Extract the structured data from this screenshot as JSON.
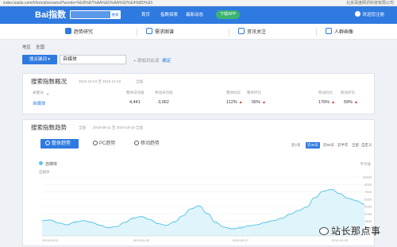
{
  "browser": {
    "url": "index.baidu.com/#/trend/seoword?words=%E8%87%AA%E5%AA%92%E4%BD%93",
    "right_info": "北京百度网讯科技有限公司"
  },
  "topnav": {
    "logo": "Bai指数",
    "search_btn": "搜索",
    "links": [
      "首页",
      "指数探索",
      "最新动态"
    ],
    "pill": "下载APP",
    "user": "欢迎您注册"
  },
  "tabs": [
    "趋势研究",
    "需求图谱",
    "资讯关注",
    "人群画像"
  ],
  "filters": {
    "region": [
      "地区",
      "全国"
    ],
    "keyword_btn": "搜关键词",
    "keyword_value": "自媒体",
    "add_compare": "+ 添加对比词",
    "confirm": "确定"
  },
  "overview": {
    "title": "搜索指数概况",
    "date_range": "2019-10-04 至 2019-10-10",
    "scope": "全国",
    "headers": [
      "关键词",
      "整体日均值",
      "移动日均值",
      "整体同比",
      "整体环比",
      "移动同比",
      "移动环比"
    ],
    "row": {
      "keyword": "自媒体",
      "overall_avg": "4,441",
      "mobile_avg": "3,062",
      "overall_yoy": "112%",
      "overall_mom": "56%",
      "mobile_yoy": "176%",
      "mobile_mom": "59%"
    }
  },
  "trend": {
    "title": "搜索指数趋势",
    "scope": "全国",
    "date_range": "2019-09-11 至 2019-10-10",
    "tabs": [
      "整体趋势",
      "PC趋势",
      "移动趋势"
    ],
    "ranges": [
      "近7天",
      "近30天",
      "近90天",
      "近半年",
      "全部",
      "自定义"
    ],
    "selected_range": "近30天",
    "legend": "自媒体",
    "avg_label": "平均值"
  },
  "chart_data": {
    "type": "area",
    "series": [
      {
        "name": "自媒体",
        "values": [
          2600,
          2700,
          2200,
          1900,
          2350,
          2600,
          2300,
          1800,
          1400,
          1600,
          2300,
          3000,
          3300,
          2800,
          2100,
          1800,
          2400,
          3400,
          4600,
          5100,
          3800,
          2300,
          1500,
          1200,
          1400,
          1700,
          1900,
          2300,
          2600,
          3000,
          3700,
          4300,
          4900,
          6500,
          7600,
          7900,
          7200,
          6400,
          6000,
          5400
        ]
      }
    ],
    "ylim": [
      0,
      10000
    ],
    "y_ticks": [
      "10000",
      "8750",
      "7500",
      "6250",
      "5000",
      "3750",
      "2500",
      "1250"
    ],
    "x_ticks": [
      "2019-09-11",
      "2019-09-19",
      "2019-09-27",
      "2019-10-05"
    ],
    "colors": {
      "line": "#5cc6e6",
      "fill": "#d8f1fa"
    }
  }
}
